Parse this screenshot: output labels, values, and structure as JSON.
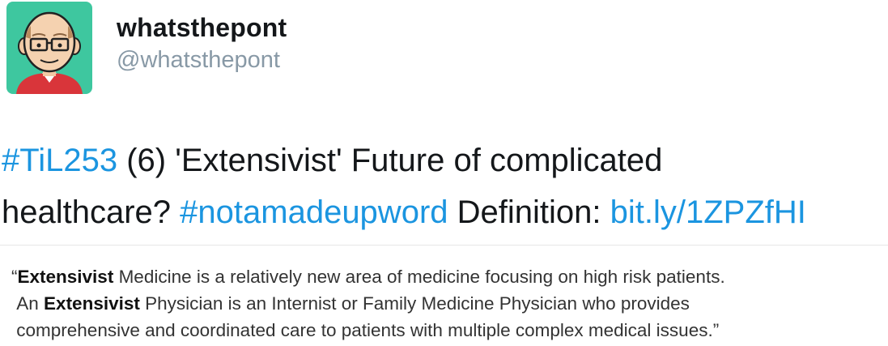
{
  "colors": {
    "link": "#1b95e0",
    "avatar_bg": "#3ec79f",
    "handle": "#8899a6"
  },
  "author": {
    "display_name": "whatsthepont",
    "handle": "@whatsthepont",
    "avatar_icon": "avatar-cartoon-man-glasses-icon"
  },
  "tweet": {
    "hashtag_1": "#TiL253",
    "text_1": " (6) 'Extensivist' Future of complicated",
    "text_2": "healthcare? ",
    "hashtag_2": "#notamadeupword",
    "text_3": " Definition: ",
    "link": "bit.ly/1ZPZfHI"
  },
  "quote_card": {
    "line1_open": "“",
    "line1_bold": "Extensivist",
    "line1_rest": " Medicine is a relatively new area of medicine focusing on high risk patients.",
    "line2_pre": "An ",
    "line2_bold": "Extensivist",
    "line2_rest": " Physician is an Internist or Family Medicine Physician who provides",
    "line3": "comprehensive and coordinated care to patients with multiple complex medical issues.”"
  }
}
